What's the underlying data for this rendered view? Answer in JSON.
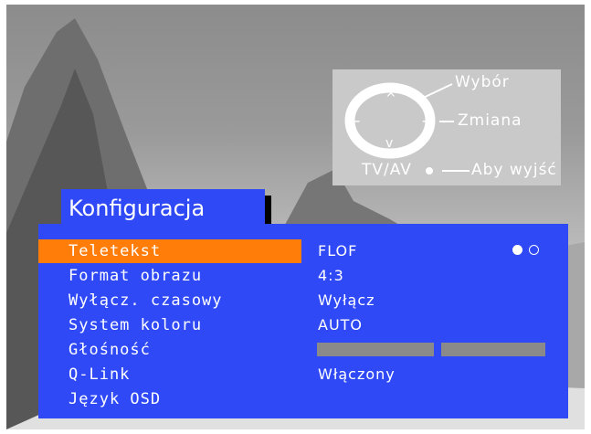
{
  "help": {
    "labels": {
      "select": "Wybór",
      "change": "Zmiana",
      "source": "TV/AV",
      "exit": "Aby wyjść"
    },
    "pad_symbols": {
      "up": "^",
      "down": "v",
      "minus": "−",
      "plus": "+"
    }
  },
  "menu": {
    "title": "Konfiguracja",
    "rows": [
      {
        "name": "Teletekst",
        "value": "FLOF",
        "selected": true
      },
      {
        "name": "Format obrazu",
        "value": "4:3"
      },
      {
        "name": "Wyłącz. czasowy",
        "value": "Wyłącz"
      },
      {
        "name": "System koloru",
        "value": "AUTO"
      },
      {
        "name": "Głośność",
        "value": ""
      },
      {
        "name": "Q-Link",
        "value": "Włączony"
      },
      {
        "name": "Język OSD",
        "value": ""
      }
    ],
    "teletext_dots": [
      "filled",
      "empty"
    ]
  },
  "colors": {
    "panel": "#2f49f6",
    "highlight": "#ff7d08",
    "volume_bar": "#8a8a8a"
  }
}
